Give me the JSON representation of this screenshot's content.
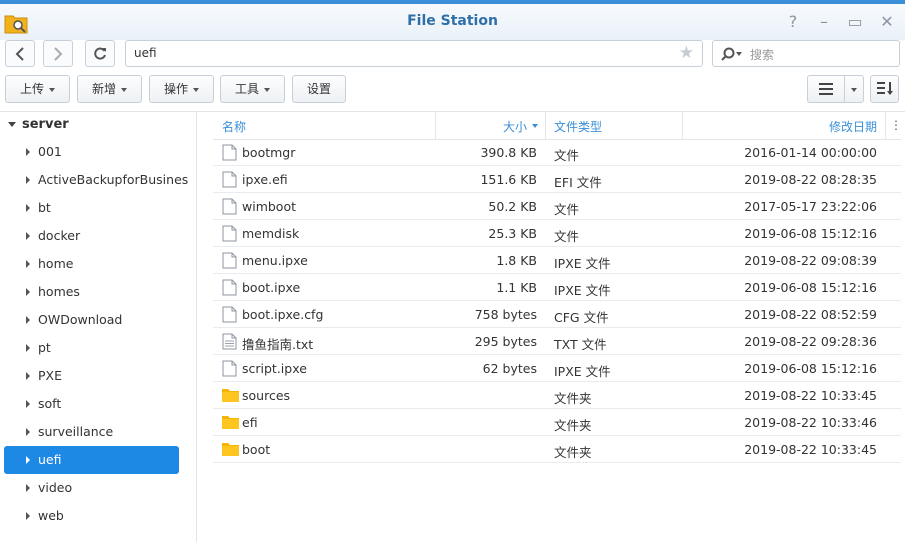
{
  "window": {
    "title": "File Station"
  },
  "path": {
    "value": "uefi"
  },
  "search": {
    "placeholder": "搜索"
  },
  "toolbar": {
    "upload": "上传",
    "create": "新增",
    "action": "操作",
    "tools": "工具",
    "settings": "设置"
  },
  "tree": {
    "root": "server",
    "items": [
      "001",
      "ActiveBackupforBusines",
      "bt",
      "docker",
      "home",
      "homes",
      "OWDownload",
      "pt",
      "PXE",
      "soft",
      "surveillance",
      "uefi",
      "video",
      "web"
    ],
    "selected": "uefi"
  },
  "columns": {
    "name": "名称",
    "size": "大小",
    "type": "文件类型",
    "modified": "修改日期"
  },
  "files": [
    {
      "name": "bootmgr",
      "size": "390.8 KB",
      "type": "文件",
      "date": "2016-01-14 00:00:00",
      "kind": "file"
    },
    {
      "name": "ipxe.efi",
      "size": "151.6 KB",
      "type": "EFI 文件",
      "date": "2019-08-22 08:28:35",
      "kind": "file"
    },
    {
      "name": "wimboot",
      "size": "50.2 KB",
      "type": "文件",
      "date": "2017-05-17 23:22:06",
      "kind": "file"
    },
    {
      "name": "memdisk",
      "size": "25.3 KB",
      "type": "文件",
      "date": "2019-06-08 15:12:16",
      "kind": "file"
    },
    {
      "name": "menu.ipxe",
      "size": "1.8 KB",
      "type": "IPXE 文件",
      "date": "2019-08-22 09:08:39",
      "kind": "file"
    },
    {
      "name": "boot.ipxe",
      "size": "1.1 KB",
      "type": "IPXE 文件",
      "date": "2019-06-08 15:12:16",
      "kind": "file"
    },
    {
      "name": "boot.ipxe.cfg",
      "size": "758 bytes",
      "type": "CFG 文件",
      "date": "2019-08-22 08:52:59",
      "kind": "file"
    },
    {
      "name": "撸鱼指南.txt",
      "size": "295 bytes",
      "type": "TXT 文件",
      "date": "2019-08-22 09:28:36",
      "kind": "text"
    },
    {
      "name": "script.ipxe",
      "size": "62 bytes",
      "type": "IPXE 文件",
      "date": "2019-06-08 15:12:16",
      "kind": "file"
    },
    {
      "name": "sources",
      "size": "",
      "type": "文件夹",
      "date": "2019-08-22 10:33:45",
      "kind": "folder"
    },
    {
      "name": "efi",
      "size": "",
      "type": "文件夹",
      "date": "2019-08-22 10:33:46",
      "kind": "folder"
    },
    {
      "name": "boot",
      "size": "",
      "type": "文件夹",
      "date": "2019-08-22 10:33:45",
      "kind": "folder"
    }
  ],
  "colors": {
    "accent": "#1e88e5",
    "title": "#2f6fa8",
    "folder": "#f5b400"
  }
}
